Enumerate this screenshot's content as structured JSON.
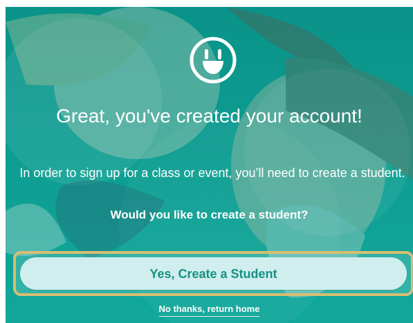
{
  "modal": {
    "logo_icon": "smiley-logo-icon",
    "title": "Great, you've created your account!",
    "message": "In order to sign up for a class or event, you’ll need to create a student.",
    "question": "Would you like to create a student?",
    "primary_button": "Yes, Create a Student",
    "secondary_link": "No thanks, return home"
  },
  "colors": {
    "overlay": "#1aa396",
    "button_fill": "#cfeeed",
    "button_text": "#169184",
    "focus_ring": "#d7be72",
    "text": "#ffffff"
  }
}
